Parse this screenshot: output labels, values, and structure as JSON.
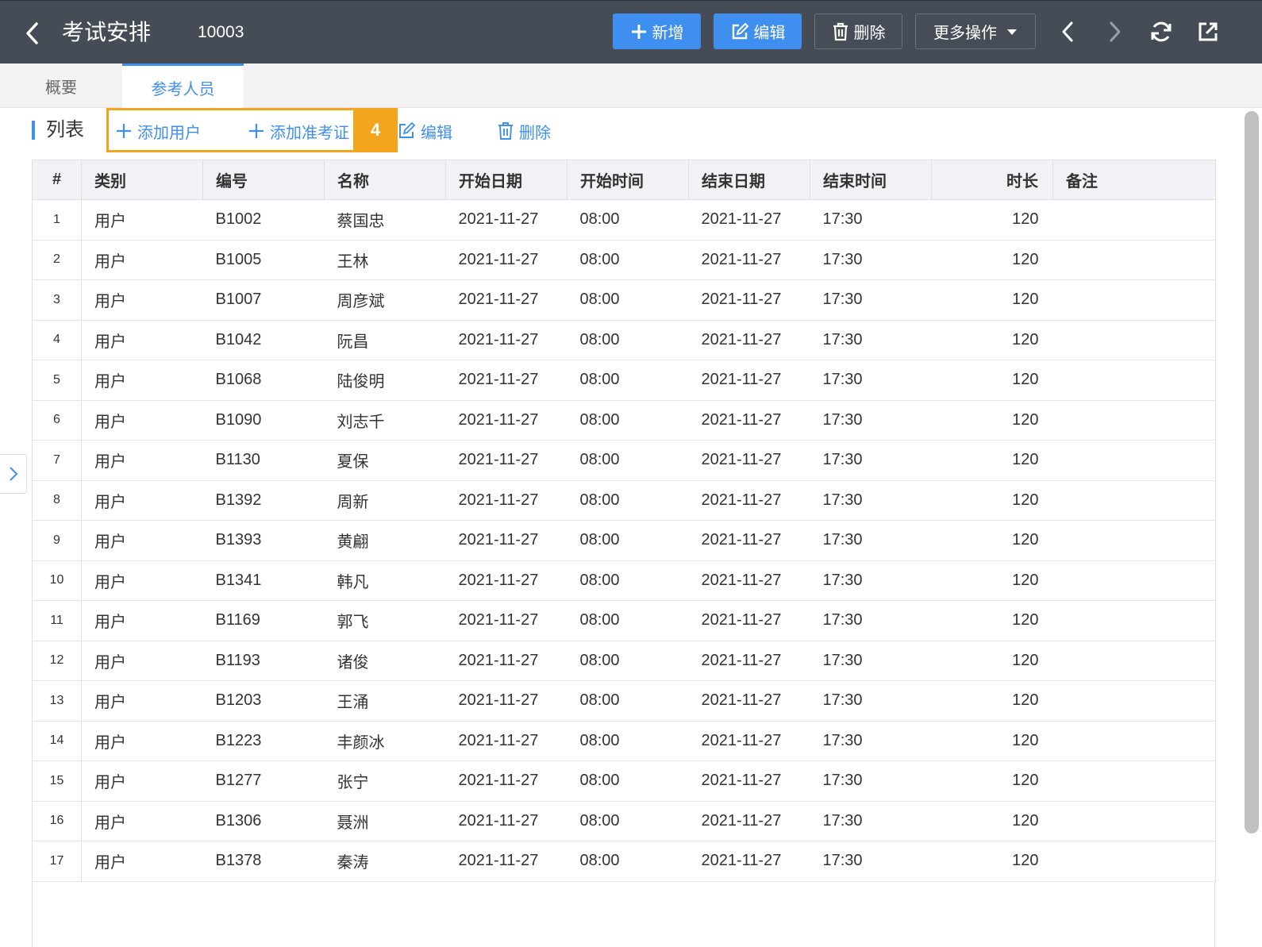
{
  "header": {
    "title": "考试安排",
    "record_id": "10003",
    "buttons": {
      "add": "新增",
      "edit": "编辑",
      "delete": "删除",
      "more": "更多操作"
    }
  },
  "tabs": [
    {
      "label": "概要"
    },
    {
      "label": "参考人员"
    }
  ],
  "section": {
    "title": "列表",
    "toolbar": {
      "add_user": "添加用户",
      "add_ticket": "添加准考证",
      "edit": "编辑",
      "delete": "删除"
    },
    "step_badge": "4"
  },
  "table": {
    "columns": [
      "#",
      "类别",
      "编号",
      "名称",
      "开始日期",
      "开始时间",
      "结束日期",
      "结束时间",
      "时长",
      "备注"
    ],
    "rows": [
      [
        "1",
        "用户",
        "B1002",
        "蔡国忠",
        "2021-11-27",
        "08:00",
        "2021-11-27",
        "17:30",
        "120",
        ""
      ],
      [
        "2",
        "用户",
        "B1005",
        "王林",
        "2021-11-27",
        "08:00",
        "2021-11-27",
        "17:30",
        "120",
        ""
      ],
      [
        "3",
        "用户",
        "B1007",
        "周彦斌",
        "2021-11-27",
        "08:00",
        "2021-11-27",
        "17:30",
        "120",
        ""
      ],
      [
        "4",
        "用户",
        "B1042",
        "阮昌",
        "2021-11-27",
        "08:00",
        "2021-11-27",
        "17:30",
        "120",
        ""
      ],
      [
        "5",
        "用户",
        "B1068",
        "陆俊明",
        "2021-11-27",
        "08:00",
        "2021-11-27",
        "17:30",
        "120",
        ""
      ],
      [
        "6",
        "用户",
        "B1090",
        "刘志千",
        "2021-11-27",
        "08:00",
        "2021-11-27",
        "17:30",
        "120",
        ""
      ],
      [
        "7",
        "用户",
        "B1130",
        "夏保",
        "2021-11-27",
        "08:00",
        "2021-11-27",
        "17:30",
        "120",
        ""
      ],
      [
        "8",
        "用户",
        "B1392",
        "周新",
        "2021-11-27",
        "08:00",
        "2021-11-27",
        "17:30",
        "120",
        ""
      ],
      [
        "9",
        "用户",
        "B1393",
        "黄翩",
        "2021-11-27",
        "08:00",
        "2021-11-27",
        "17:30",
        "120",
        ""
      ],
      [
        "10",
        "用户",
        "B1341",
        "韩凡",
        "2021-11-27",
        "08:00",
        "2021-11-27",
        "17:30",
        "120",
        ""
      ],
      [
        "11",
        "用户",
        "B1169",
        "郭飞",
        "2021-11-27",
        "08:00",
        "2021-11-27",
        "17:30",
        "120",
        ""
      ],
      [
        "12",
        "用户",
        "B1193",
        "诸俊",
        "2021-11-27",
        "08:00",
        "2021-11-27",
        "17:30",
        "120",
        ""
      ],
      [
        "13",
        "用户",
        "B1203",
        "王涌",
        "2021-11-27",
        "08:00",
        "2021-11-27",
        "17:30",
        "120",
        ""
      ],
      [
        "14",
        "用户",
        "B1223",
        "丰颜冰",
        "2021-11-27",
        "08:00",
        "2021-11-27",
        "17:30",
        "120",
        ""
      ],
      [
        "15",
        "用户",
        "B1277",
        "张宁",
        "2021-11-27",
        "08:00",
        "2021-11-27",
        "17:30",
        "120",
        ""
      ],
      [
        "16",
        "用户",
        "B1306",
        "聂洲",
        "2021-11-27",
        "08:00",
        "2021-11-27",
        "17:30",
        "120",
        ""
      ],
      [
        "17",
        "用户",
        "B1378",
        "秦涛",
        "2021-11-27",
        "08:00",
        "2021-11-27",
        "17:30",
        "120",
        ""
      ]
    ]
  },
  "colors": {
    "header_bg": "#464c55",
    "accent": "#3f8ff0",
    "highlight": "#f2a51d"
  },
  "icons": [
    "chevron-left-icon",
    "plus-icon",
    "edit-icon",
    "trash-icon",
    "caret-down-icon",
    "chevron-right-icon",
    "refresh-icon",
    "share-icon"
  ]
}
